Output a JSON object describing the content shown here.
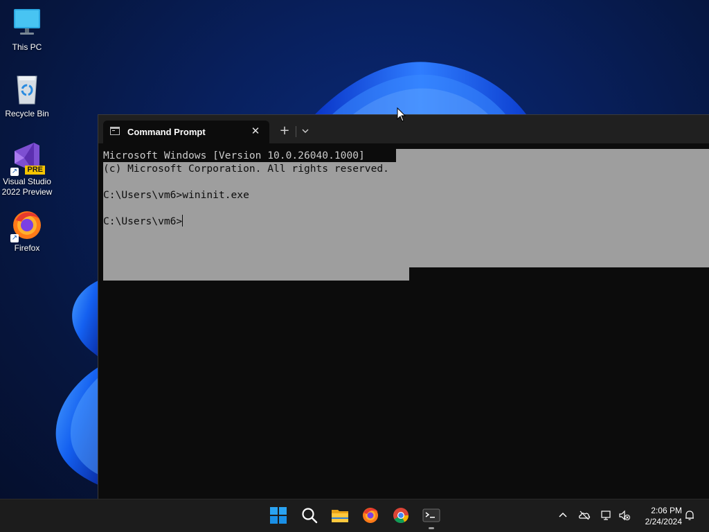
{
  "desktop": {
    "icons": [
      {
        "label": "This PC",
        "icon": "monitor-icon"
      },
      {
        "label": "Recycle Bin",
        "icon": "recycle-bin-icon"
      },
      {
        "label": "Visual Studio\n2022 Preview",
        "icon": "visual-studio-icon",
        "badge": "PRE"
      },
      {
        "label": "Firefox",
        "icon": "firefox-icon"
      }
    ]
  },
  "terminal": {
    "tab_title": "Command Prompt",
    "close_glyph": "✕",
    "new_tab_glyph": "+",
    "lines": [
      "Microsoft Windows [Version 10.0.26040.1000]",
      "(c) Microsoft Corporation. All rights reserved.",
      "C:\\Users\\vm6>wininit.exe",
      "C:\\Users\\vm6>"
    ],
    "colors": {
      "background": "#0c0c0c",
      "text": "#cccccc",
      "selection": "#9e9e9e"
    }
  },
  "taskbar": {
    "apps": [
      "start-icon",
      "search-icon",
      "file-explorer-icon",
      "firefox-icon",
      "chrome-icon",
      "terminal-icon"
    ],
    "tray": [
      "chevron-up-icon",
      "onedrive-icon",
      "network-icon",
      "volume-muted-icon",
      "notification-bell-icon"
    ],
    "clock": {
      "time": "2:06 PM",
      "date": "2/24/2024"
    }
  }
}
